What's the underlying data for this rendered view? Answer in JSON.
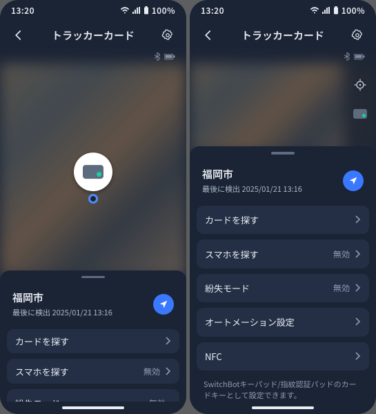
{
  "statusbar": {
    "time": "13:20",
    "battery": "100%"
  },
  "header": {
    "title": "トラッカーカード"
  },
  "location": {
    "city": "福岡市",
    "sub": "最後に検出 2025/01/21 13:16"
  },
  "tiles": {
    "find_card": "カードを探す",
    "find_phone": "スマホを探す",
    "lost_mode": "紛失モード",
    "automation": "オートメーション設定",
    "nfc": "NFC",
    "disabled": "無効"
  },
  "caption": "SwitchBotキーパッド/指紋認証パッドのカードキーとして設定できます。"
}
